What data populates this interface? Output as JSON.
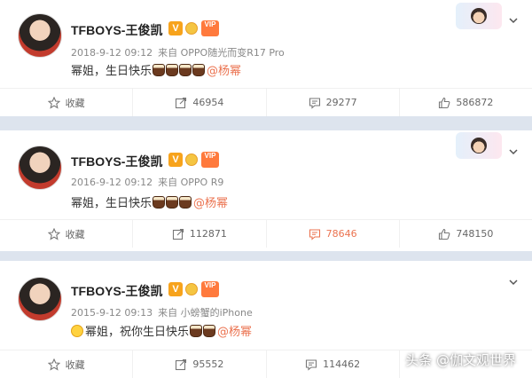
{
  "colors": {
    "page_bg": "#dde4ee",
    "accent": "#eb7350",
    "vip": "#ff7a3d",
    "v_badge": "#f7a31c"
  },
  "icons": [
    "star-icon",
    "share-icon",
    "comment-icon",
    "like-icon",
    "chevron-down-icon",
    "cake-emoji-icon"
  ],
  "posts": [
    {
      "author": "TFBOYS-王俊凯",
      "badge_v": "V",
      "vip_label": "VIP",
      "meta_time": "2018-9-12 09:12",
      "meta_source": "来自 OPPO随光而变R17 Pro",
      "text": "幂姐，生日快乐",
      "cakes": 4,
      "mention": "@杨幂",
      "actions": {
        "favorite": "收藏",
        "share": "46954",
        "comment": "29277",
        "like": "586872"
      }
    },
    {
      "author": "TFBOYS-王俊凯",
      "badge_v": "V",
      "vip_label": "VIP",
      "meta_time": "2016-9-12 09:12",
      "meta_source": "来自 OPPO R9",
      "text": "幂姐，生日快乐",
      "cakes": 3,
      "mention": "@杨幂",
      "actions": {
        "favorite": "收藏",
        "share": "112871",
        "comment": "78646",
        "like": "748150"
      }
    },
    {
      "author": "TFBOYS-王俊凯",
      "badge_v": "V",
      "vip_label": "VIP",
      "meta_time": "2015-9-12 09:13",
      "meta_source": "来自 小螃蟹的iPhone",
      "text": "幂姐，祝你生日快乐",
      "cakes": 2,
      "mention": "@杨幂",
      "actions": {
        "favorite": "收藏",
        "share": "95552",
        "comment": "114462",
        "like": ""
      }
    }
  ],
  "watermark": "头条 @伽文观世界"
}
